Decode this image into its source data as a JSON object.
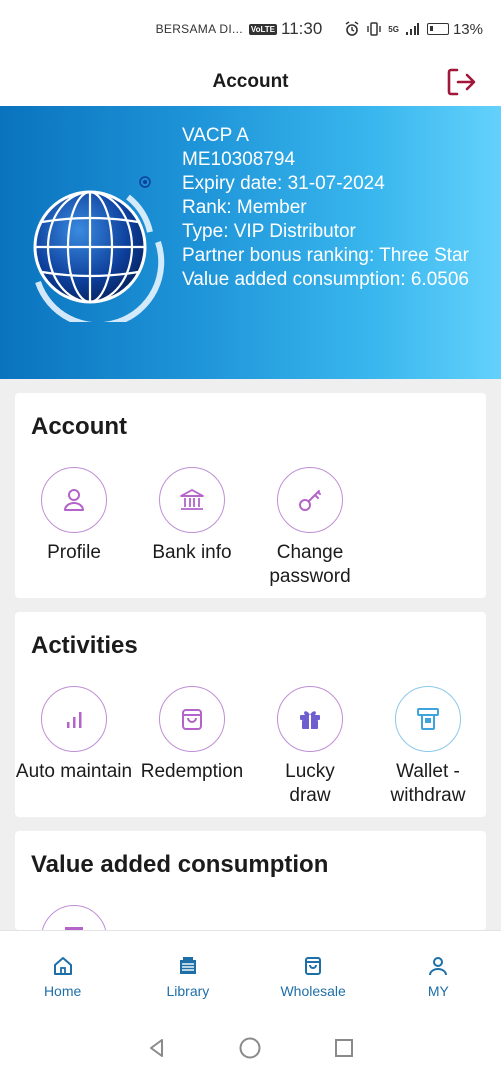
{
  "status_bar": {
    "carrier": "BERSAMA DI...",
    "volte": "VoLTE",
    "time": "11:30",
    "signal": "5G",
    "battery": "13%"
  },
  "header": {
    "title": "Account"
  },
  "profile": {
    "name": "VACP A",
    "member_id": "ME10308794",
    "expiry": "Expiry date: 31-07-2024",
    "rank": "Rank: Member",
    "type": "Type: VIP Distributor",
    "partner_bonus": "Partner bonus ranking: Three Star",
    "value_added": "Value added consumption: 6.0506"
  },
  "account_section": {
    "title": "Account",
    "items": [
      {
        "label": "Profile",
        "icon": "person-icon"
      },
      {
        "label": "Bank info",
        "icon": "bank-icon"
      },
      {
        "label": "Change password",
        "icon": "key-icon"
      }
    ]
  },
  "activities_section": {
    "title": "Activities",
    "items": [
      {
        "label": "Auto maintain",
        "icon": "bar-chart-icon"
      },
      {
        "label": "Redemption",
        "icon": "bag-icon"
      },
      {
        "label": "Lucky draw",
        "icon": "gift-icon"
      },
      {
        "label": "Wallet - withdraw",
        "icon": "atm-icon"
      }
    ]
  },
  "value_section": {
    "title": "Value added consumption"
  },
  "bottom_nav": {
    "items": [
      {
        "label": "Home",
        "icon": "home-icon"
      },
      {
        "label": "Library",
        "icon": "library-icon"
      },
      {
        "label": "Wholesale",
        "icon": "bag-icon"
      },
      {
        "label": "MY",
        "icon": "user-icon"
      }
    ]
  },
  "colors": {
    "accent": "#1e6fa8",
    "icon_purple": "#b363c9",
    "logout_red": "#a0173a",
    "banner_start": "#0a73be",
    "banner_end": "#63d1fb"
  }
}
